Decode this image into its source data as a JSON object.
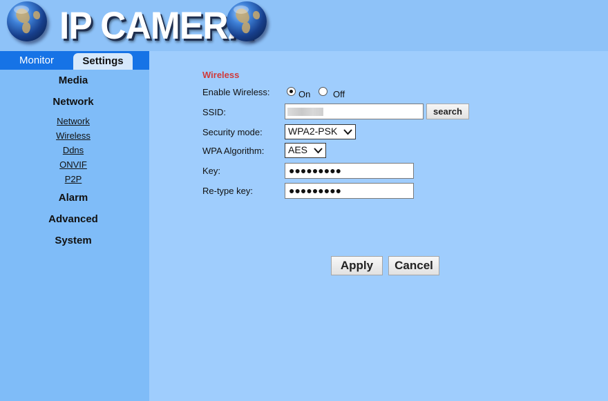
{
  "header": {
    "logo_text": "IP CAMERA"
  },
  "tabs": {
    "monitor": "Monitor",
    "settings": "Settings"
  },
  "sidebar": {
    "media": "Media",
    "network": "Network",
    "network_links": [
      "Network",
      "Wireless",
      "Ddns",
      "ONVIF",
      "P2P"
    ],
    "alarm": "Alarm",
    "advanced": "Advanced",
    "system": "System"
  },
  "wireless": {
    "title": "Wireless",
    "enable_label": "Enable Wireless:",
    "enable_on": "On",
    "enable_off": "Off",
    "enable_value": "On",
    "ssid_label": "SSID:",
    "ssid_value": "",
    "search_label": "search",
    "security_label": "Security mode:",
    "security_value": "WPA2-PSK",
    "algorithm_label": "WPA Algorithm:",
    "algorithm_value": "AES",
    "key_label": "Key:",
    "key_value": "●●●●●●●●●",
    "retype_label": "Re-type key:",
    "retype_value": "●●●●●●●●●"
  },
  "actions": {
    "apply": "Apply",
    "cancel": "Cancel"
  },
  "colors": {
    "background": "#9fcdfd",
    "sidebar": "#7fbcf8",
    "tab_bar": "#1673e6",
    "section_title": "#d03a3a"
  }
}
